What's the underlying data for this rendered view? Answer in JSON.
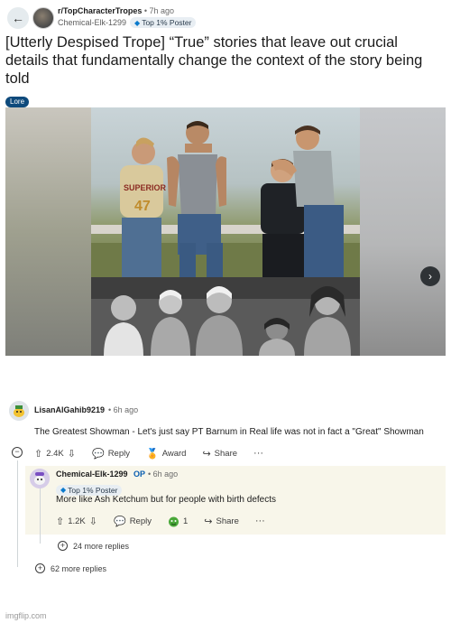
{
  "post": {
    "subreddit": "r/TopCharacterTropes",
    "separator": " • ",
    "time": "7h ago",
    "author": "Chemical-Elk-1299",
    "author_flair": "Top 1% Poster",
    "title": "[Utterly Despised Trope] “True” stories that leave out crucial details that fundamentally change the context of the story being told",
    "tag": "Lore"
  },
  "icons": {
    "back": "←",
    "next": "›",
    "flair": "◆",
    "upvote": "⇧",
    "downvote": "⇩",
    "reply": "💬",
    "award": "🏅",
    "share": "↪",
    "more": "···",
    "collapse": "−",
    "expand": "+"
  },
  "comment": {
    "author": "LisanAlGahib9219",
    "time": "6h ago",
    "body": "The Greatest Showman - Let's just say PT Barnum in Real life was not in fact a \"Great\" Showman",
    "score": "2.4K",
    "reply_label": "Reply",
    "award_label": "Award",
    "share_label": "Share",
    "more_replies": "62 more replies"
  },
  "reply": {
    "author": "Chemical-Elk-1299",
    "op_label": "OP",
    "time": "6h ago",
    "flair": "Top 1% Poster",
    "body": "More like Ash Ketchum but for people with birth defects",
    "score": "1.2K",
    "reply_label": "Reply",
    "award_count": "1",
    "share_label": "Share",
    "more_replies": "24 more replies"
  },
  "watermark": "imgflip.com"
}
